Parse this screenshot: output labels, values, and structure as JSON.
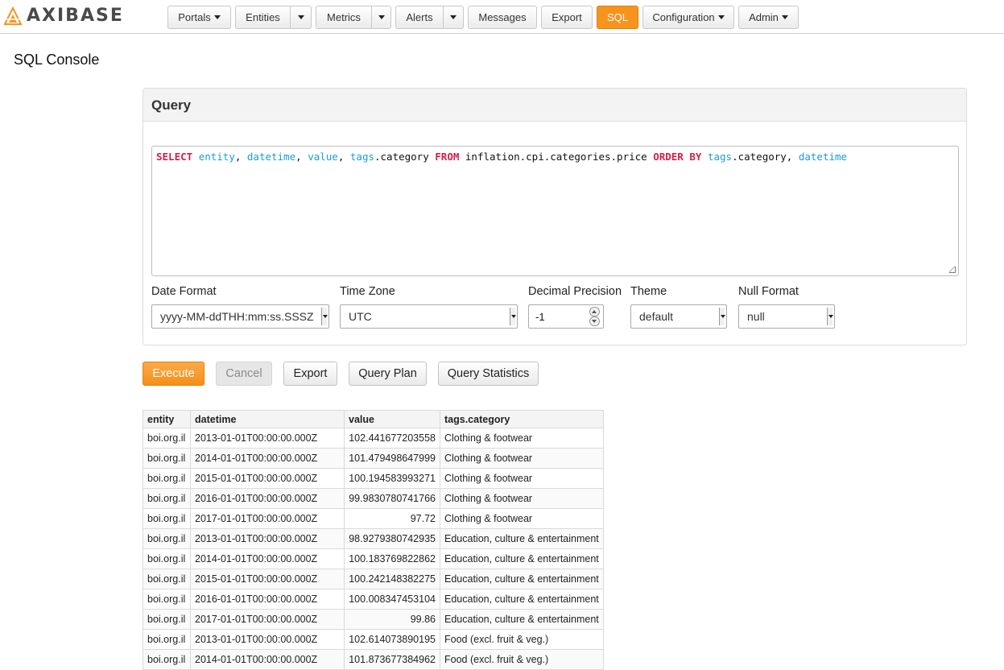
{
  "brand": {
    "name": "AXIBASE"
  },
  "nav": {
    "portals": "Portals",
    "entities": "Entities",
    "metrics": "Metrics",
    "alerts": "Alerts",
    "messages": "Messages",
    "export": "Export",
    "sql": "SQL",
    "configuration": "Configuration",
    "admin": "Admin"
  },
  "page": {
    "title": "SQL Console"
  },
  "query_panel": {
    "heading": "Query",
    "sql_tokens": [
      {
        "t": "SELECT",
        "k": "kw"
      },
      {
        "t": " ",
        "k": "plain"
      },
      {
        "t": "entity",
        "k": "col"
      },
      {
        "t": ", ",
        "k": "plain"
      },
      {
        "t": "datetime",
        "k": "col"
      },
      {
        "t": ", ",
        "k": "plain"
      },
      {
        "t": "value",
        "k": "col"
      },
      {
        "t": ", ",
        "k": "plain"
      },
      {
        "t": "tags",
        "k": "col"
      },
      {
        "t": ".category ",
        "k": "plain"
      },
      {
        "t": "FROM",
        "k": "kw"
      },
      {
        "t": " inflation.cpi.categories.price ",
        "k": "plain"
      },
      {
        "t": "ORDER BY",
        "k": "kw"
      },
      {
        "t": " ",
        "k": "plain"
      },
      {
        "t": "tags",
        "k": "col"
      },
      {
        "t": ".category, ",
        "k": "plain"
      },
      {
        "t": "datetime",
        "k": "col"
      }
    ],
    "options": {
      "date_format_label": "Date Format",
      "date_format_value": "yyyy-MM-ddTHH:mm:ss.SSSZ",
      "time_zone_label": "Time Zone",
      "time_zone_value": "UTC",
      "decimal_precision_label": "Decimal Precision",
      "decimal_precision_value": "-1",
      "theme_label": "Theme",
      "theme_value": "default",
      "null_format_label": "Null Format",
      "null_format_value": "null"
    }
  },
  "actions": {
    "execute": "Execute",
    "cancel": "Cancel",
    "export": "Export",
    "query_plan": "Query Plan",
    "query_statistics": "Query Statistics"
  },
  "results": {
    "columns": [
      "entity",
      "datetime",
      "value",
      "tags.category"
    ],
    "rows": [
      [
        "boi.org.il",
        "2013-01-01T00:00:00.000Z",
        "102.441677203558",
        "Clothing & footwear"
      ],
      [
        "boi.org.il",
        "2014-01-01T00:00:00.000Z",
        "101.479498647999",
        "Clothing & footwear"
      ],
      [
        "boi.org.il",
        "2015-01-01T00:00:00.000Z",
        "100.194583993271",
        "Clothing & footwear"
      ],
      [
        "boi.org.il",
        "2016-01-01T00:00:00.000Z",
        "99.9830780741766",
        "Clothing & footwear"
      ],
      [
        "boi.org.il",
        "2017-01-01T00:00:00.000Z",
        "97.72",
        "Clothing & footwear"
      ],
      [
        "boi.org.il",
        "2013-01-01T00:00:00.000Z",
        "98.9279380742935",
        "Education, culture & entertainment"
      ],
      [
        "boi.org.il",
        "2014-01-01T00:00:00.000Z",
        "100.183769822862",
        "Education, culture & entertainment"
      ],
      [
        "boi.org.il",
        "2015-01-01T00:00:00.000Z",
        "100.242148382275",
        "Education, culture & entertainment"
      ],
      [
        "boi.org.il",
        "2016-01-01T00:00:00.000Z",
        "100.008347453104",
        "Education, culture & entertainment"
      ],
      [
        "boi.org.il",
        "2017-01-01T00:00:00.000Z",
        "99.86",
        "Education, culture & entertainment"
      ],
      [
        "boi.org.il",
        "2013-01-01T00:00:00.000Z",
        "102.614073890195",
        "Food (excl. fruit & veg.)"
      ],
      [
        "boi.org.il",
        "2014-01-01T00:00:00.000Z",
        "101.873677384962",
        "Food (excl. fruit & veg.)"
      ]
    ]
  },
  "colors": {
    "accent": "#f7941d",
    "keyword": "#d3204b",
    "identifier": "#1a9dd9"
  }
}
